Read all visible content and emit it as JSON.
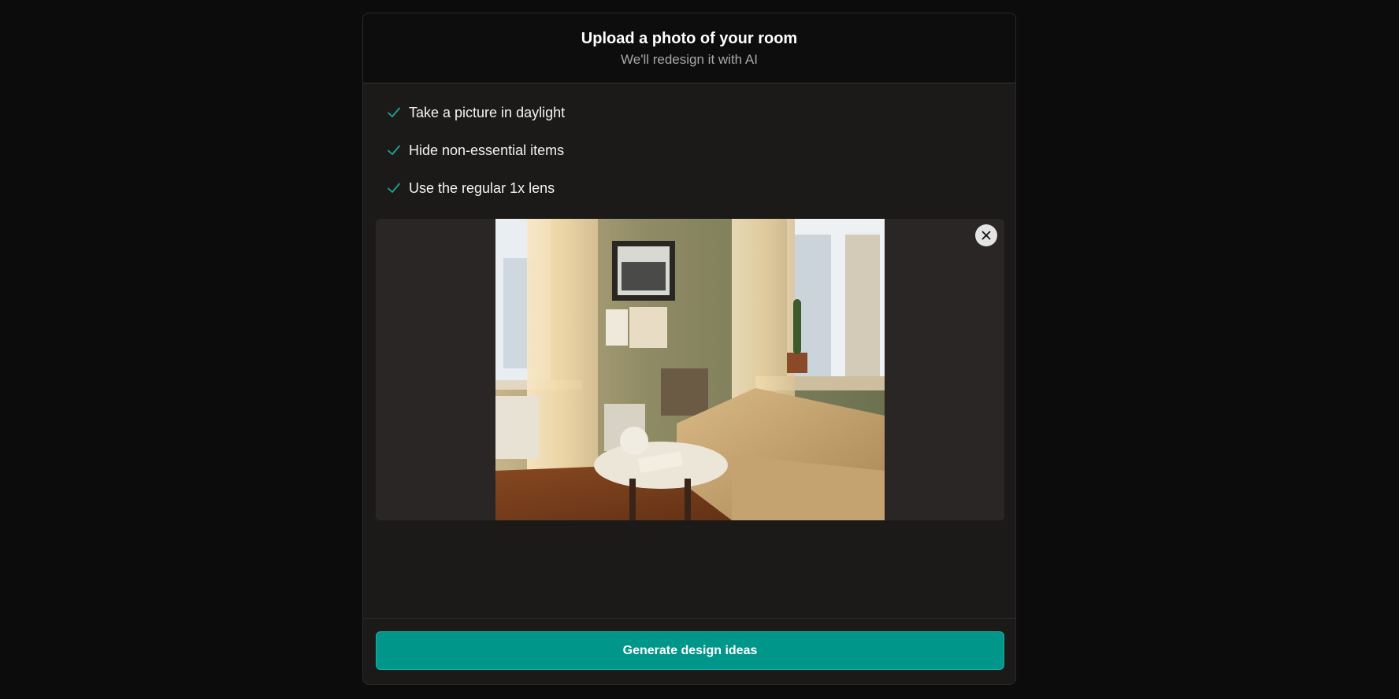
{
  "header": {
    "title": "Upload a photo of your room",
    "subtitle": "We'll redesign it with AI"
  },
  "tips": [
    {
      "icon": "check-icon",
      "label": "Take a picture in daylight"
    },
    {
      "icon": "check-icon",
      "label": "Hide non-essential items"
    },
    {
      "icon": "check-icon",
      "label": "Use the regular 1x lens"
    }
  ],
  "preview": {
    "remove_icon": "close-icon"
  },
  "footer": {
    "generate_label": "Generate design ideas"
  },
  "colors": {
    "accent": "#00978a",
    "check": "#1aa596",
    "background": "#0c0c0c",
    "panel": "#1c1a19"
  }
}
